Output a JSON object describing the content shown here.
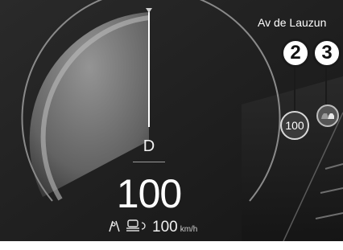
{
  "street": {
    "name": "Av de Lauzun"
  },
  "speedometer": {
    "gear": "D",
    "speed": "100"
  },
  "driver_assist": {
    "set_speed": "100",
    "unit": "km/h",
    "icons": [
      "lane-keeping-icon",
      "adaptive-cruise-control-icon"
    ]
  },
  "speed_limit": {
    "value": "100"
  },
  "callouts": {
    "limit_number": "2",
    "vehicle_number": "3"
  },
  "icons": {
    "vehicle_detected": "vehicle-detection-icon"
  },
  "colors": {
    "background": "#1f1f1f",
    "gauge_fill": "#9a9a9a",
    "needle": "#ffffff",
    "text": "#ffffff"
  }
}
